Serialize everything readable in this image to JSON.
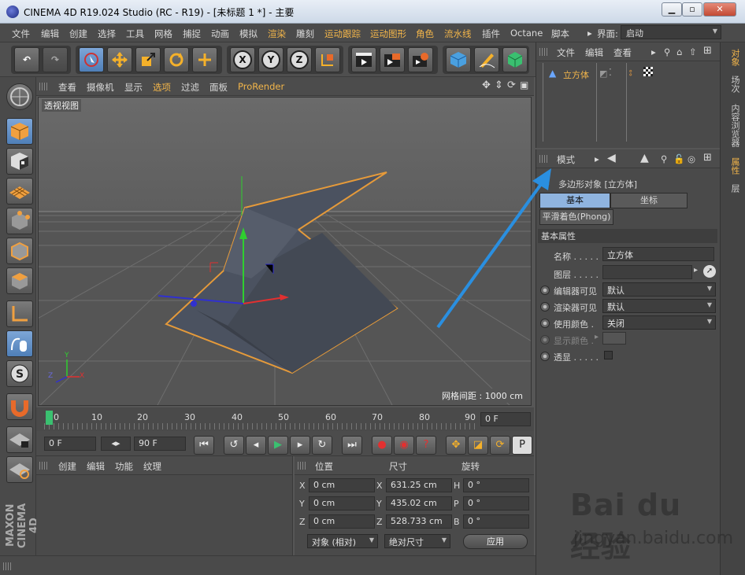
{
  "window": {
    "title": "CINEMA 4D R19.024 Studio (RC - R19) - [未标题 1 *] - 主要",
    "min": "▁",
    "max": "▫",
    "close": "✕"
  },
  "menubar": [
    "文件",
    "编辑",
    "创建",
    "选择",
    "工具",
    "网格",
    "捕捉",
    "动画",
    "模拟",
    "渲染",
    "雕刻",
    "运动跟踪",
    "运动图形",
    "角色",
    "流水线",
    "插件",
    "Octane",
    "脚本"
  ],
  "highlighted_menus": [
    "渲染",
    "运动跟踪",
    "运动图形",
    "角色",
    "流水线"
  ],
  "layout": {
    "label": "界面:",
    "value": "启动"
  },
  "viewport": {
    "menu": [
      "查看",
      "摄像机",
      "显示",
      "选项",
      "过滤",
      "面板",
      "ProRender"
    ],
    "view_name": "透视视图",
    "grid_spacing": "网格间距 : 1000 cm",
    "axis_y": "Y",
    "axis_x": "X",
    "axis_z": "Z"
  },
  "timeline": {
    "ticks": [
      "0",
      "10",
      "20",
      "30",
      "40",
      "50",
      "60",
      "70",
      "80",
      "90"
    ],
    "frame_field": "0 F"
  },
  "transport": {
    "start": "0 F",
    "end": "90 F"
  },
  "material_menu": [
    "创建",
    "编辑",
    "功能",
    "纹理"
  ],
  "coords": {
    "headers": {
      "position": "位置",
      "size": "尺寸",
      "rotation": "旋转"
    },
    "rows": [
      {
        "axis": "X",
        "pos": "0 cm",
        "saxis": "X",
        "size": "631.25 cm",
        "raxis": "H",
        "rot": "0 °"
      },
      {
        "axis": "Y",
        "pos": "0 cm",
        "saxis": "Y",
        "size": "435.02 cm",
        "raxis": "P",
        "rot": "0 °"
      },
      {
        "axis": "Z",
        "pos": "0 cm",
        "saxis": "Z",
        "size": "528.733 cm",
        "raxis": "B",
        "rot": "0 °"
      }
    ],
    "mode": "对象 (相对)",
    "size_mode": "绝对尺寸",
    "apply": "应用"
  },
  "object_manager": {
    "menu": [
      "文件",
      "编辑",
      "查看"
    ],
    "object": "立方体"
  },
  "attribute_manager": {
    "mode": "模式",
    "object_title": "多边形对象 [立方体]",
    "tabs": [
      "基本",
      "坐标"
    ],
    "subtab": "平滑着色(Phong)",
    "section": "基本属性",
    "fields": {
      "name_label": "名称 . . . . .",
      "name_value": "立方体",
      "layer_label": "图层 . . . . .",
      "editor_vis_label": "编辑器可见",
      "editor_vis_value": "默认",
      "render_vis_label": "渲染器可见",
      "render_vis_value": "默认",
      "use_color_label": "使用颜色 .",
      "use_color_value": "关闭",
      "display_color_label": "显示颜色 .",
      "xray_label": "透显 . . . . ."
    }
  },
  "side_tabs": [
    "对象",
    "场次",
    "内容浏览器",
    "属性",
    "层"
  ],
  "brand": "MAXON CINEMA 4D",
  "watermark": {
    "logo": "Bai du 经验",
    "url": "jingyan.baidu.com"
  }
}
